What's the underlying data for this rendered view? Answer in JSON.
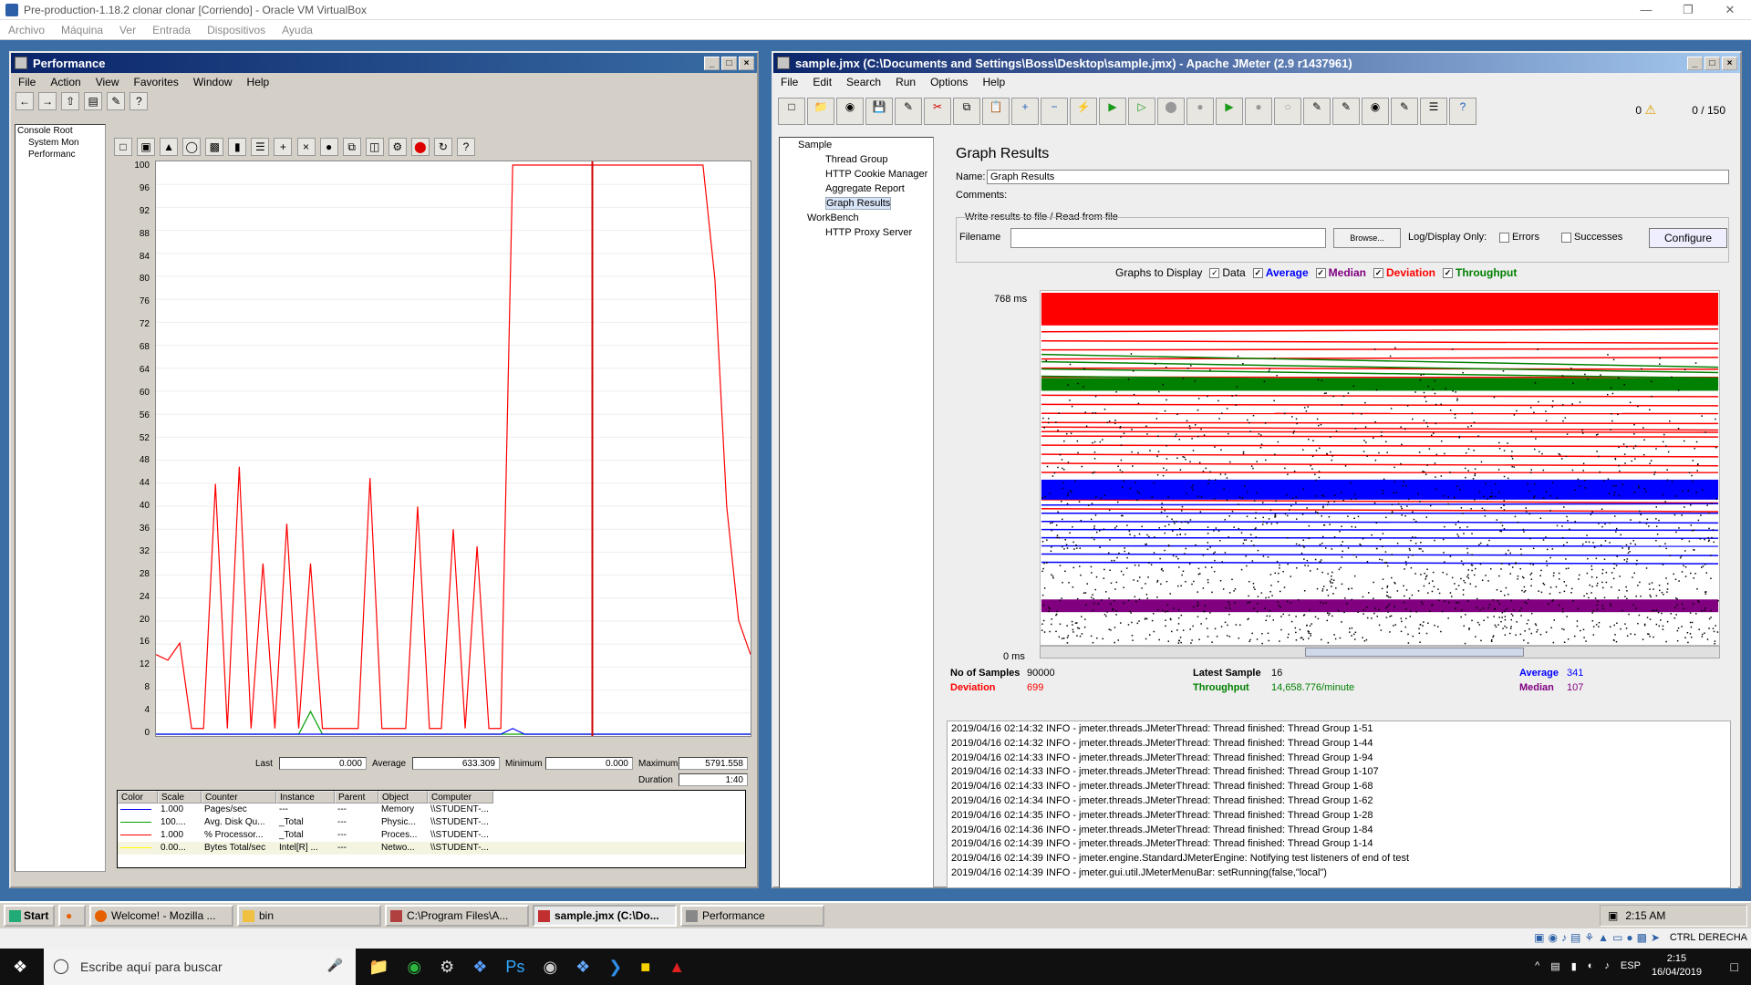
{
  "vbox": {
    "title": "Pre-production-1.18.2 clonar clonar [Corriendo] - Oracle VM VirtualBox",
    "menu": [
      "Archivo",
      "Máquina",
      "Ver",
      "Entrada",
      "Dispositivos",
      "Ayuda"
    ]
  },
  "perf": {
    "title": "Performance",
    "menu": [
      "File",
      "Action",
      "View",
      "Favorites",
      "Window",
      "Help"
    ],
    "tree": [
      "Console Root",
      "System Mon",
      "Performanc"
    ],
    "y_ticks": [
      "100",
      "96",
      "92",
      "88",
      "84",
      "80",
      "76",
      "72",
      "68",
      "64",
      "60",
      "56",
      "52",
      "48",
      "44",
      "40",
      "36",
      "32",
      "28",
      "24",
      "20",
      "16",
      "12",
      "8",
      "4",
      "0"
    ],
    "stats": {
      "last_label": "Last",
      "last": "0.000",
      "avg_label": "Average",
      "avg": "633.309",
      "min_label": "Minimum",
      "min": "0.000",
      "max_label": "Maximum",
      "max": "5791.558",
      "dur_label": "Duration",
      "dur": "1:40"
    },
    "legend_headers": [
      "Color",
      "Scale",
      "Counter",
      "Instance",
      "Parent",
      "Object",
      "Computer"
    ],
    "legend_rows": [
      {
        "color": "#0000ff",
        "scale": "1.000",
        "counter": "Pages/sec",
        "instance": "---",
        "parent": "---",
        "object": "Memory",
        "computer": "\\\\STUDENT-..."
      },
      {
        "color": "#00a000",
        "scale": "100....",
        "counter": "Avg. Disk Qu...",
        "instance": "_Total",
        "parent": "---",
        "object": "Physic...",
        "computer": "\\\\STUDENT-..."
      },
      {
        "color": "#ff0000",
        "scale": "1.000",
        "counter": "% Processor...",
        "instance": "_Total",
        "parent": "---",
        "object": "Proces...",
        "computer": "\\\\STUDENT-..."
      },
      {
        "color": "#ffff00",
        "scale": "0.00...",
        "counter": "Bytes Total/sec",
        "instance": "Intel[R] ...",
        "parent": "---",
        "object": "Netwo...",
        "computer": "\\\\STUDENT-..."
      }
    ]
  },
  "jmeter": {
    "title": "sample.jmx (C:\\Documents and Settings\\Boss\\Desktop\\sample.jmx) - Apache JMeter (2.9 r1437961)",
    "menu": [
      "File",
      "Edit",
      "Search",
      "Run",
      "Options",
      "Help"
    ],
    "counter_errors": "0",
    "counter_threads": "0 / 150",
    "tree": [
      "Sample",
      "Thread Group",
      "HTTP Cookie Manager",
      "Aggregate Report",
      "Graph Results",
      "WorkBench",
      "HTTP Proxy Server"
    ],
    "panel_title": "Graph Results",
    "name_label": "Name:",
    "name_value": "Graph Results",
    "comments_label": "Comments:",
    "write_section": "Write results to file / Read from file",
    "filename_label": "Filename",
    "browse": "Browse...",
    "log_display": "Log/Display Only:",
    "errors": "Errors",
    "successes": "Successes",
    "configure": "Configure",
    "graphs_to_display": "Graphs to Display",
    "series": [
      {
        "name": "Data",
        "color": "#000000"
      },
      {
        "name": "Average",
        "color": "#0000ff"
      },
      {
        "name": "Median",
        "color": "#800080"
      },
      {
        "name": "Deviation",
        "color": "#ff0000"
      },
      {
        "name": "Throughput",
        "color": "#008000"
      }
    ],
    "ymax": "768 ms",
    "ymin": "0 ms",
    "summary": {
      "samples_label": "No of Samples",
      "samples": "90000",
      "latest_label": "Latest Sample",
      "latest": "16",
      "average_label": "Average",
      "average": "341",
      "deviation_label": "Deviation",
      "deviation": "699",
      "throughput_label": "Throughput",
      "throughput": "14,658.776/minute",
      "median_label": "Median",
      "median": "107"
    },
    "log": [
      "2019/04/16 02:14:32 INFO  - jmeter.threads.JMeterThread: Thread finished: Thread Group 1-51",
      "2019/04/16 02:14:32 INFO  - jmeter.threads.JMeterThread: Thread finished: Thread Group 1-44",
      "2019/04/16 02:14:33 INFO  - jmeter.threads.JMeterThread: Thread finished: Thread Group 1-94",
      "2019/04/16 02:14:33 INFO  - jmeter.threads.JMeterThread: Thread finished: Thread Group 1-107",
      "2019/04/16 02:14:33 INFO  - jmeter.threads.JMeterThread: Thread finished: Thread Group 1-68",
      "2019/04/16 02:14:34 INFO  - jmeter.threads.JMeterThread: Thread finished: Thread Group 1-62",
      "2019/04/16 02:14:35 INFO  - jmeter.threads.JMeterThread: Thread finished: Thread Group 1-28",
      "2019/04/16 02:14:36 INFO  - jmeter.threads.JMeterThread: Thread finished: Thread Group 1-84",
      "2019/04/16 02:14:39 INFO  - jmeter.threads.JMeterThread: Thread finished: Thread Group 1-14",
      "2019/04/16 02:14:39 INFO  - jmeter.engine.StandardJMeterEngine: Notifying test listeners of end of test",
      "2019/04/16 02:14:39 INFO  - jmeter.gui.util.JMeterMenuBar: setRunning(false,\"local\")"
    ]
  },
  "guest_taskbar": {
    "start": "Start",
    "tasks": [
      "Welcome! - Mozilla ...",
      "bin",
      "C:\\Program Files\\A...",
      "sample.jmx (C:\\Do...",
      "Performance"
    ],
    "clock": "2:15 AM"
  },
  "vbox_status": {
    "host_key": "CTRL DERECHA"
  },
  "host_taskbar": {
    "search_placeholder": "Escribe aquí para buscar",
    "lang": "ESP",
    "time": "2:15",
    "date": "16/04/2019"
  },
  "chart_data": {
    "type": "line",
    "title": "",
    "ylim": [
      0,
      100
    ],
    "x": [
      0,
      2,
      4,
      6,
      8,
      10,
      12,
      14,
      16,
      18,
      20,
      22,
      24,
      26,
      28,
      30,
      32,
      34,
      36,
      38,
      40,
      42,
      44,
      46,
      48,
      50,
      52,
      54,
      56,
      58,
      60,
      62,
      64,
      66,
      68,
      70,
      72,
      74,
      76,
      78,
      80,
      82,
      84,
      86,
      88,
      90,
      92,
      94,
      96,
      98,
      100
    ],
    "series": [
      {
        "name": "% Processor...",
        "color": "#ff0000",
        "values": [
          14,
          13,
          16,
          1,
          1,
          44,
          1,
          47,
          1,
          30,
          1,
          37,
          1,
          30,
          1,
          1,
          1,
          1,
          45,
          1,
          1,
          1,
          40,
          1,
          1,
          36,
          1,
          33,
          1,
          1,
          100,
          100,
          100,
          100,
          100,
          100,
          100,
          100,
          100,
          100,
          100,
          100,
          100,
          100,
          100,
          100,
          100,
          80,
          40,
          20,
          14
        ]
      },
      {
        "name": "Avg. Disk Qu...",
        "color": "#00a000",
        "values": [
          0,
          0,
          0,
          0,
          0,
          0,
          0,
          0,
          0,
          0,
          0,
          0,
          0,
          4,
          0,
          0,
          0,
          0,
          0,
          0,
          0,
          0,
          0,
          0,
          0,
          0,
          0,
          0,
          0,
          0,
          0,
          0,
          0,
          0,
          0,
          0,
          0,
          0,
          0,
          0,
          0,
          0,
          0,
          0,
          0,
          0,
          0,
          0,
          0,
          0,
          0
        ]
      },
      {
        "name": "Pages/sec",
        "color": "#0000ff",
        "values": [
          0,
          0,
          0,
          0,
          0,
          0,
          0,
          0,
          0,
          0,
          0,
          0,
          0,
          0,
          0,
          0,
          0,
          0,
          0,
          0,
          0,
          0,
          0,
          0,
          0,
          0,
          0,
          0,
          0,
          0,
          1,
          0,
          0,
          0,
          0,
          0,
          0,
          0,
          0,
          0,
          0,
          0,
          0,
          0,
          0,
          0,
          0,
          0,
          0,
          0,
          0
        ]
      }
    ]
  }
}
